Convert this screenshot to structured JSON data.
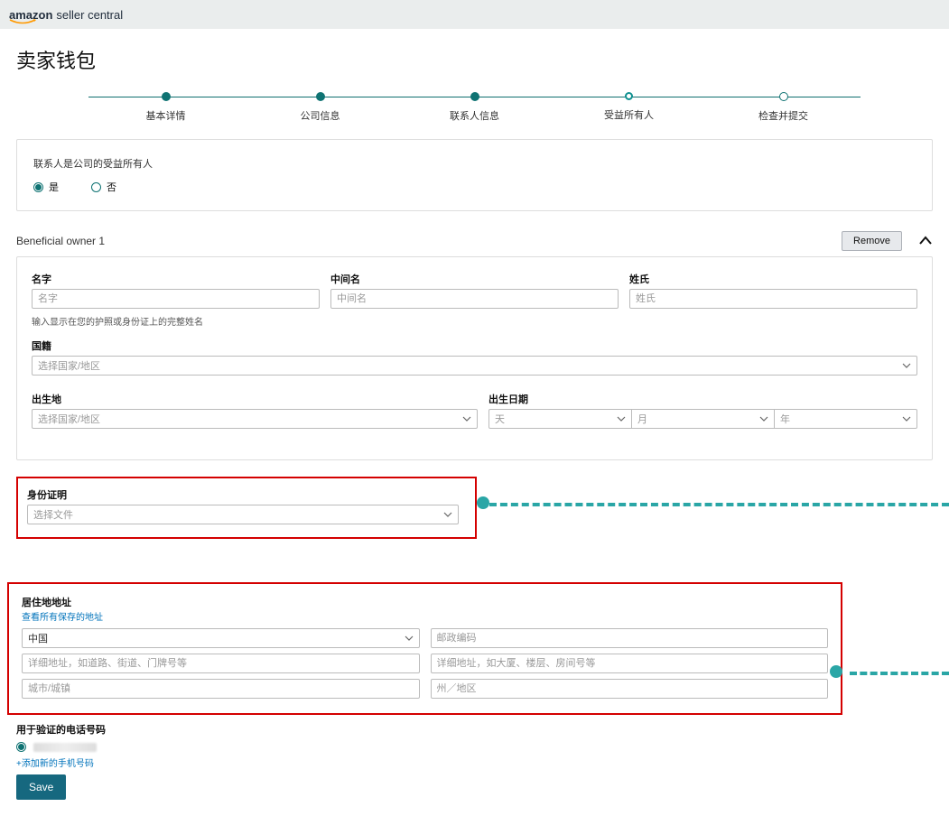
{
  "header": {
    "brand_a": "amazon",
    "brand_b": "seller central"
  },
  "page_title": "卖家钱包",
  "steps": [
    "基本详情",
    "公司信息",
    "联系人信息",
    "受益所有人",
    "检查并提交"
  ],
  "question": {
    "label": "联系人是公司的受益所有人",
    "yes": "是",
    "no": "否"
  },
  "owner": {
    "section_title": "Beneficial owner 1",
    "remove": "Remove",
    "fields": {
      "first_name_label": "名字",
      "first_name_ph": "名字",
      "middle_name_label": "中间名",
      "middle_name_ph": "中间名",
      "last_name_label": "姓氏",
      "last_name_ph": "姓氏",
      "name_hint": "输入显示在您的护照或身份证上的完整姓名",
      "nationality_label": "国籍",
      "nationality_ph": "选择国家/地区",
      "birthplace_label": "出生地",
      "birthplace_ph": "选择国家/地区",
      "dob_label": "出生日期",
      "day_ph": "天",
      "month_ph": "月",
      "year_ph": "年"
    }
  },
  "identity": {
    "label": "身份证明",
    "ph": "选择文件"
  },
  "address": {
    "label": "居住地地址",
    "view_saved": "查看所有保存的地址",
    "country_value": "中国",
    "postal_ph": "邮政编码",
    "line1_ph": "详细地址，如道路、街道、门牌号等",
    "line2_ph": "详细地址，如大厦、楼层、房间号等",
    "city_ph": "城市/城镇",
    "state_ph": "州／地区"
  },
  "phone": {
    "label": "用于验证的电话号码",
    "add_new": "+添加新的手机号码"
  },
  "save": "Save"
}
